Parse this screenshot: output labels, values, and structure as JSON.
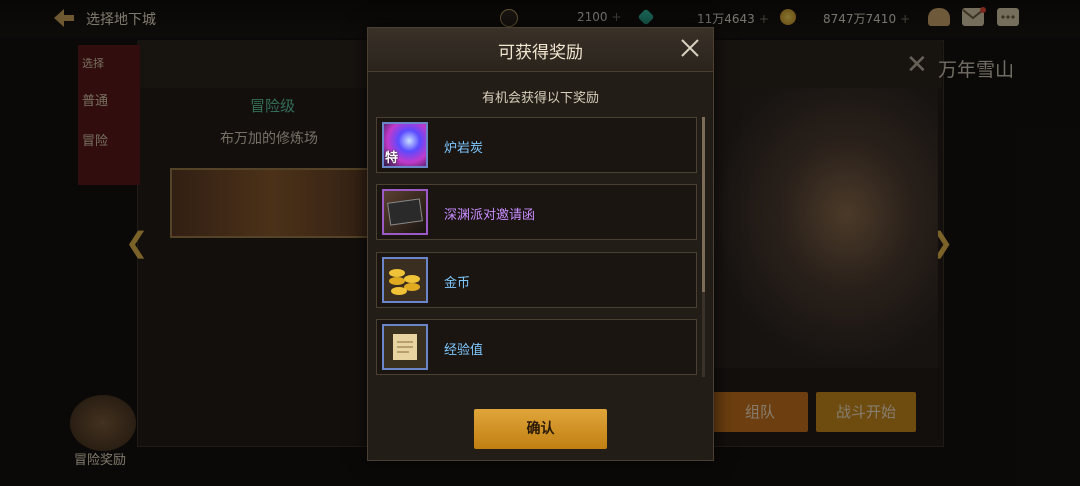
{
  "topbar": {
    "back_label": "选择地下城",
    "resources": [
      {
        "icon": "moon-coin-icon",
        "value": "2100"
      },
      {
        "icon": "gem-icon",
        "value": "11万4643"
      },
      {
        "icon": "gold-coin-icon",
        "value": "8747万7410"
      }
    ],
    "plus": "+",
    "icons": [
      "cake-icon",
      "mail-icon",
      "chat-icon"
    ]
  },
  "background": {
    "banner_items": [
      "选择",
      "普通",
      "冒险"
    ],
    "difficulty": "冒险级",
    "dungeon_name": "布万加的修炼场",
    "title": "万年雪山",
    "team_button": "组队",
    "fight_button": "战斗开始",
    "adventure_reward": "冒险奖励"
  },
  "modal": {
    "title": "可获得奖励",
    "subtitle": "有机会获得以下奖励",
    "confirm": "确认",
    "items": [
      {
        "name": "炉岩炭",
        "color": "#7fc8ff",
        "icon": "lava-stone-icon",
        "badge": "特"
      },
      {
        "name": "深渊派对邀请函",
        "color": "#c98cff",
        "icon": "invitation-card-icon"
      },
      {
        "name": "金币",
        "color": "#7fc8ff",
        "icon": "gold-coins-icon"
      },
      {
        "name": "经验值",
        "color": "#7fc8ff",
        "icon": "scroll-icon"
      }
    ]
  }
}
